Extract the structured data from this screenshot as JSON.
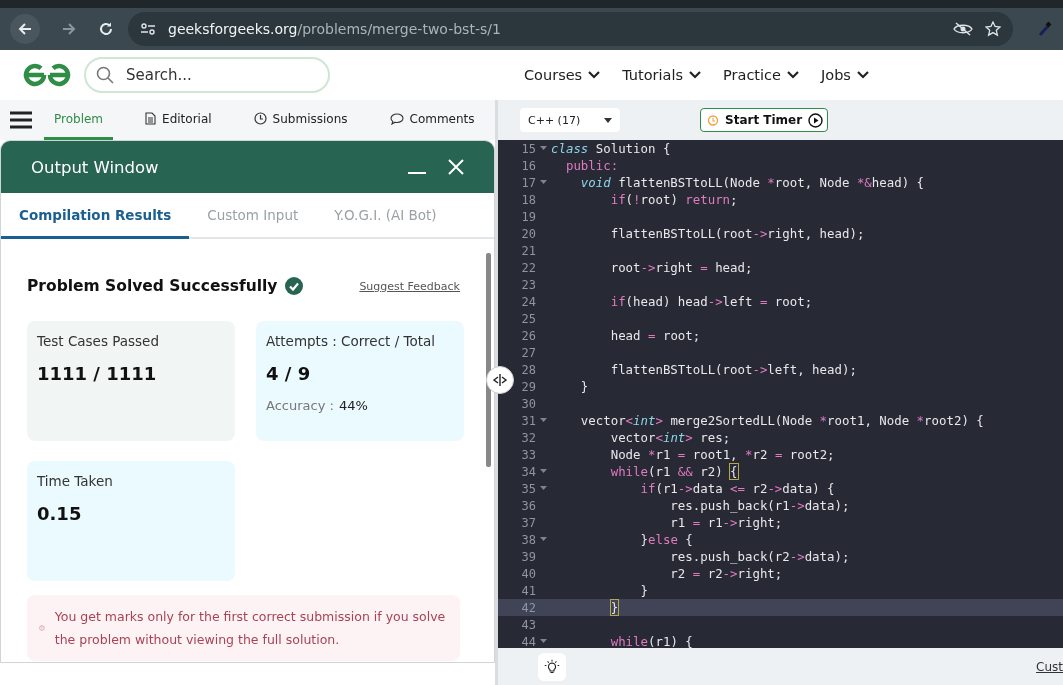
{
  "browser": {
    "url_host": "geeksforgeeks.org",
    "url_path": "/problems/merge-two-bst-s/1"
  },
  "header": {
    "search": {
      "placeholder": "Search..."
    },
    "nav": [
      {
        "label": "Courses"
      },
      {
        "label": "Tutorials"
      },
      {
        "label": "Practice"
      },
      {
        "label": "Jobs"
      }
    ]
  },
  "problem_tabs": [
    {
      "label": "Problem",
      "selected": true
    },
    {
      "label": "Editorial",
      "selected": false
    },
    {
      "label": "Submissions",
      "selected": false
    },
    {
      "label": "Comments",
      "selected": false
    }
  ],
  "output_window": {
    "title": "Output Window",
    "tabs": [
      {
        "label": "Compilation Results",
        "selected": true
      },
      {
        "label": "Custom Input",
        "selected": false
      },
      {
        "label": "Y.O.G.I. (AI Bot)",
        "selected": false
      }
    ],
    "status": "Problem Solved Successfully",
    "feedback_link": "Suggest Feedback",
    "cards": [
      {
        "label": "Test Cases Passed",
        "value": "1111 / 1111"
      },
      {
        "label": "Attempts : Correct / Total",
        "value": "4 / 9",
        "note_label": "Accuracy :",
        "note_value": "44%"
      },
      {
        "label": "Time Taken",
        "value": "0.15"
      }
    ],
    "notice": "You get marks only for the first correct submission if you solve the problem without viewing the full solution."
  },
  "editor": {
    "language": "C++ (17)",
    "timer_button": "Start Timer",
    "lines": [
      {
        "number": "15",
        "fold": true,
        "current": false,
        "tokens": [
          {
            "kind": "type",
            "text": "class"
          },
          {
            "kind": "plain",
            "text": " Solution {"
          }
        ]
      },
      {
        "number": "16",
        "fold": false,
        "current": false,
        "tokens": [
          {
            "kind": "keyword",
            "text": "  public:"
          }
        ]
      },
      {
        "number": "17",
        "fold": true,
        "current": false,
        "tokens": [
          {
            "kind": "type",
            "text": "    void"
          },
          {
            "kind": "plain",
            "text": " flattenBSTtoLL(Node "
          },
          {
            "kind": "op",
            "text": "*"
          },
          {
            "kind": "plain",
            "text": "root, Node "
          },
          {
            "kind": "op",
            "text": "*&"
          },
          {
            "kind": "plain",
            "text": "head) {"
          }
        ]
      },
      {
        "number": "18",
        "fold": false,
        "current": false,
        "tokens": [
          {
            "kind": "keyword",
            "text": "        if"
          },
          {
            "kind": "plain",
            "text": "("
          },
          {
            "kind": "op",
            "text": "!"
          },
          {
            "kind": "plain",
            "text": "root) "
          },
          {
            "kind": "keyword",
            "text": "return"
          },
          {
            "kind": "plain",
            "text": ";"
          }
        ]
      },
      {
        "number": "19",
        "fold": false,
        "current": false
      },
      {
        "number": "20",
        "fold": false,
        "current": false,
        "tokens": [
          {
            "kind": "plain",
            "text": "        flattenBSTtoLL(root"
          },
          {
            "kind": "op",
            "text": "->"
          },
          {
            "kind": "plain",
            "text": "right, head);"
          }
        ]
      },
      {
        "number": "21",
        "fold": false,
        "current": false
      },
      {
        "number": "22",
        "fold": false,
        "current": false,
        "tokens": [
          {
            "kind": "plain",
            "text": "        root"
          },
          {
            "kind": "op",
            "text": "->"
          },
          {
            "kind": "plain",
            "text": "right "
          },
          {
            "kind": "op",
            "text": "="
          },
          {
            "kind": "plain",
            "text": " head;"
          }
        ]
      },
      {
        "number": "23",
        "fold": false,
        "current": false
      },
      {
        "number": "24",
        "fold": false,
        "current": false,
        "tokens": [
          {
            "kind": "keyword",
            "text": "        if"
          },
          {
            "kind": "plain",
            "text": "(head) head"
          },
          {
            "kind": "op",
            "text": "->"
          },
          {
            "kind": "plain",
            "text": "left "
          },
          {
            "kind": "op",
            "text": "="
          },
          {
            "kind": "plain",
            "text": " root;"
          }
        ]
      },
      {
        "number": "25",
        "fold": false,
        "current": false
      },
      {
        "number": "26",
        "fold": false,
        "current": false,
        "tokens": [
          {
            "kind": "plain",
            "text": "        head "
          },
          {
            "kind": "op",
            "text": "="
          },
          {
            "kind": "plain",
            "text": " root;"
          }
        ]
      },
      {
        "number": "27",
        "fold": false,
        "current": false
      },
      {
        "number": "28",
        "fold": false,
        "current": false,
        "tokens": [
          {
            "kind": "plain",
            "text": "        flattenBSTtoLL(root"
          },
          {
            "kind": "op",
            "text": "->"
          },
          {
            "kind": "plain",
            "text": "left, head);"
          }
        ]
      },
      {
        "number": "29",
        "fold": false,
        "current": false,
        "tokens": [
          {
            "kind": "plain",
            "text": "    }"
          }
        ]
      },
      {
        "number": "30",
        "fold": false,
        "current": false
      },
      {
        "number": "31",
        "fold": true,
        "current": false,
        "tokens": [
          {
            "kind": "plain",
            "text": "    vector"
          },
          {
            "kind": "op",
            "text": "<"
          },
          {
            "kind": "type",
            "text": "int"
          },
          {
            "kind": "op",
            "text": ">"
          },
          {
            "kind": "plain",
            "text": " merge2SortedLL(Node "
          },
          {
            "kind": "op",
            "text": "*"
          },
          {
            "kind": "plain",
            "text": "root1, Node "
          },
          {
            "kind": "op",
            "text": "*"
          },
          {
            "kind": "plain",
            "text": "root2) {"
          }
        ]
      },
      {
        "number": "32",
        "fold": false,
        "current": false,
        "tokens": [
          {
            "kind": "plain",
            "text": "        vector"
          },
          {
            "kind": "op",
            "text": "<"
          },
          {
            "kind": "type",
            "text": "int"
          },
          {
            "kind": "op",
            "text": ">"
          },
          {
            "kind": "plain",
            "text": " res;"
          }
        ]
      },
      {
        "number": "33",
        "fold": false,
        "current": false,
        "tokens": [
          {
            "kind": "plain",
            "text": "        Node "
          },
          {
            "kind": "op",
            "text": "*"
          },
          {
            "kind": "plain",
            "text": "r1 "
          },
          {
            "kind": "op",
            "text": "="
          },
          {
            "kind": "plain",
            "text": " root1, "
          },
          {
            "kind": "op",
            "text": "*"
          },
          {
            "kind": "plain",
            "text": "r2 "
          },
          {
            "kind": "op",
            "text": "="
          },
          {
            "kind": "plain",
            "text": " root2;"
          }
        ]
      },
      {
        "number": "34",
        "fold": true,
        "current": false,
        "tokens": [
          {
            "kind": "keyword",
            "text": "        while"
          },
          {
            "kind": "plain",
            "text": "(r1 "
          },
          {
            "kind": "op",
            "text": "&&"
          },
          {
            "kind": "plain",
            "text": " r2) "
          },
          {
            "kind": "match",
            "text": "{"
          }
        ]
      },
      {
        "number": "35",
        "fold": true,
        "current": false,
        "tokens": [
          {
            "kind": "keyword",
            "text": "            if"
          },
          {
            "kind": "plain",
            "text": "(r1"
          },
          {
            "kind": "op",
            "text": "->"
          },
          {
            "kind": "plain",
            "text": "data "
          },
          {
            "kind": "op",
            "text": "<="
          },
          {
            "kind": "plain",
            "text": " r2"
          },
          {
            "kind": "op",
            "text": "->"
          },
          {
            "kind": "plain",
            "text": "data) {"
          }
        ]
      },
      {
        "number": "36",
        "fold": false,
        "current": false,
        "tokens": [
          {
            "kind": "plain",
            "text": "                res.push_back(r1"
          },
          {
            "kind": "op",
            "text": "->"
          },
          {
            "kind": "plain",
            "text": "data);"
          }
        ]
      },
      {
        "number": "37",
        "fold": false,
        "current": false,
        "tokens": [
          {
            "kind": "plain",
            "text": "                r1 "
          },
          {
            "kind": "op",
            "text": "="
          },
          {
            "kind": "plain",
            "text": " r1"
          },
          {
            "kind": "op",
            "text": "->"
          },
          {
            "kind": "plain",
            "text": "right;"
          }
        ]
      },
      {
        "number": "38",
        "fold": true,
        "current": false,
        "tokens": [
          {
            "kind": "plain",
            "text": "            }"
          },
          {
            "kind": "keyword",
            "text": "else"
          },
          {
            "kind": "plain",
            "text": " {"
          }
        ]
      },
      {
        "number": "39",
        "fold": false,
        "current": false,
        "tokens": [
          {
            "kind": "plain",
            "text": "                res.push_back(r2"
          },
          {
            "kind": "op",
            "text": "->"
          },
          {
            "kind": "plain",
            "text": "data);"
          }
        ]
      },
      {
        "number": "40",
        "fold": false,
        "current": false,
        "tokens": [
          {
            "kind": "plain",
            "text": "                r2 "
          },
          {
            "kind": "op",
            "text": "="
          },
          {
            "kind": "plain",
            "text": " r2"
          },
          {
            "kind": "op",
            "text": "->"
          },
          {
            "kind": "plain",
            "text": "right;"
          }
        ]
      },
      {
        "number": "41",
        "fold": false,
        "current": false,
        "tokens": [
          {
            "kind": "plain",
            "text": "            }"
          }
        ]
      },
      {
        "number": "42",
        "fold": false,
        "current": true,
        "tokens": [
          {
            "kind": "match",
            "text": "        }"
          }
        ]
      },
      {
        "number": "43",
        "fold": false,
        "current": false
      },
      {
        "number": "44",
        "fold": true,
        "current": false,
        "tokens": [
          {
            "kind": "keyword",
            "text": "        while"
          },
          {
            "kind": "plain",
            "text": "(r1) {"
          }
        ]
      }
    ],
    "footer_link": "Cust"
  }
}
